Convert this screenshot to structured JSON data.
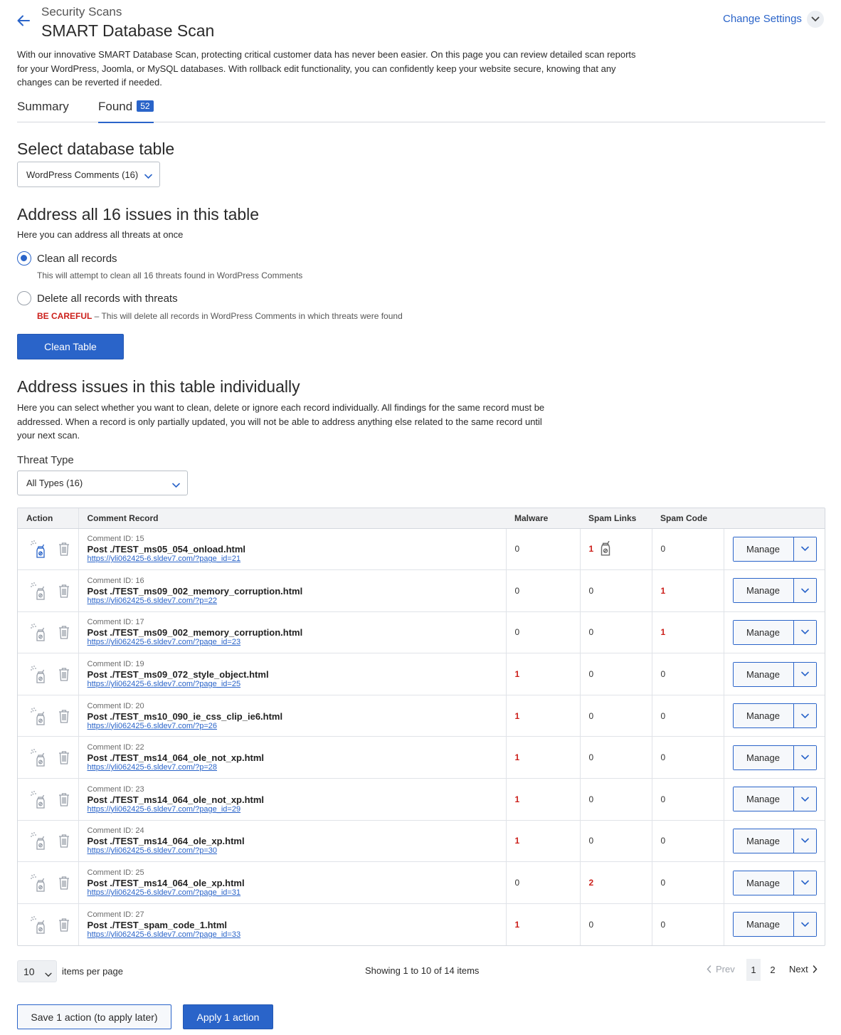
{
  "header": {
    "breadcrumb": "Security Scans",
    "title": "SMART Database Scan",
    "settings_label": "Change Settings",
    "intro": "With our innovative SMART Database Scan, protecting critical customer data has never been easier. On this page you can review detailed scan reports for your WordPress, Joomla, or MySQL databases. With rollback edit functionality, you can confidently keep your website secure, knowing that any changes can be reverted if needed."
  },
  "tabs": {
    "summary": "Summary",
    "found": "Found",
    "found_count": "52",
    "active": "Found"
  },
  "select_table": {
    "heading": "Select database table",
    "value": "WordPress Comments (16)"
  },
  "address_all": {
    "heading": "Address all 16 issues in this table",
    "subheading": "Here you can address all threats at once",
    "option_clean_label": "Clean all records",
    "option_clean_desc": "This will attempt to clean all 16 threats found in WordPress Comments",
    "option_delete_label": "Delete all records with threats",
    "option_delete_warning": "BE CAREFUL",
    "option_delete_desc": " – This will delete all records in WordPress Comments in which threats were found",
    "selected": "clean",
    "button": "Clean Table"
  },
  "address_individual": {
    "heading": "Address issues in this table individually",
    "description": "Here you can select whether you want to clean, delete or ignore each record individually. All findings for the same record must be addressed. When a record is only partially updated, you will not be able to address anything else related to the same record until your next scan.",
    "threat_type_label": "Threat Type",
    "threat_type_value": "All Types (16)"
  },
  "table": {
    "columns": [
      "Action",
      "Comment Record",
      "Malware",
      "Spam Links",
      "Spam Code",
      ""
    ],
    "manage_label": "Manage",
    "rows": [
      {
        "id": "Comment ID: 15",
        "title": "Post ./TEST_ms05_054_onload.html",
        "url": "https://yli062425-6.sldev7.com/?page_id=21",
        "malware": "0",
        "spam_links": "1",
        "spam_code": "0",
        "clean_active": true,
        "links_clean_icon": true
      },
      {
        "id": "Comment ID: 16",
        "title": "Post ./TEST_ms09_002_memory_corruption.html",
        "url": "https://yli062425-6.sldev7.com/?p=22",
        "malware": "0",
        "spam_links": "0",
        "spam_code": "1",
        "clean_active": false,
        "links_clean_icon": false
      },
      {
        "id": "Comment ID: 17",
        "title": "Post ./TEST_ms09_002_memory_corruption.html",
        "url": "https://yli062425-6.sldev7.com/?page_id=23",
        "malware": "0",
        "spam_links": "0",
        "spam_code": "1",
        "clean_active": false,
        "links_clean_icon": false
      },
      {
        "id": "Comment ID: 19",
        "title": "Post ./TEST_ms09_072_style_object.html",
        "url": "https://yli062425-6.sldev7.com/?page_id=25",
        "malware": "1",
        "spam_links": "0",
        "spam_code": "0",
        "clean_active": false,
        "links_clean_icon": false
      },
      {
        "id": "Comment ID: 20",
        "title": "Post ./TEST_ms10_090_ie_css_clip_ie6.html",
        "url": "https://yli062425-6.sldev7.com/?p=26",
        "malware": "1",
        "spam_links": "0",
        "spam_code": "0",
        "clean_active": false,
        "links_clean_icon": false
      },
      {
        "id": "Comment ID: 22",
        "title": "Post ./TEST_ms14_064_ole_not_xp.html",
        "url": "https://yli062425-6.sldev7.com/?p=28",
        "malware": "1",
        "spam_links": "0",
        "spam_code": "0",
        "clean_active": false,
        "links_clean_icon": false
      },
      {
        "id": "Comment ID: 23",
        "title": "Post ./TEST_ms14_064_ole_not_xp.html",
        "url": "https://yli062425-6.sldev7.com/?page_id=29",
        "malware": "1",
        "spam_links": "0",
        "spam_code": "0",
        "clean_active": false,
        "links_clean_icon": false
      },
      {
        "id": "Comment ID: 24",
        "title": "Post ./TEST_ms14_064_ole_xp.html",
        "url": "https://yli062425-6.sldev7.com/?p=30",
        "malware": "1",
        "spam_links": "0",
        "spam_code": "0",
        "clean_active": false,
        "links_clean_icon": false
      },
      {
        "id": "Comment ID: 25",
        "title": "Post ./TEST_ms14_064_ole_xp.html",
        "url": "https://yli062425-6.sldev7.com/?page_id=31",
        "malware": "0",
        "spam_links": "2",
        "spam_code": "0",
        "clean_active": false,
        "links_clean_icon": false
      },
      {
        "id": "Comment ID: 27",
        "title": "Post ./TEST_spam_code_1.html",
        "url": "https://yli062425-6.sldev7.com/?page_id=33",
        "malware": "1",
        "spam_links": "0",
        "spam_code": "0",
        "clean_active": false,
        "links_clean_icon": false
      }
    ]
  },
  "pagination": {
    "per_page_value": "10",
    "per_page_label": "items per page",
    "showing": "Showing 1 to 10 of 14 items",
    "prev": "Prev",
    "next": "Next",
    "pages": [
      "1",
      "2"
    ],
    "current_page": "1"
  },
  "actions": {
    "save_later": "Save 1 action (to apply later)",
    "apply": "Apply 1 action"
  },
  "colors": {
    "accent": "#2a64c9",
    "danger": "#cc1f1a"
  }
}
